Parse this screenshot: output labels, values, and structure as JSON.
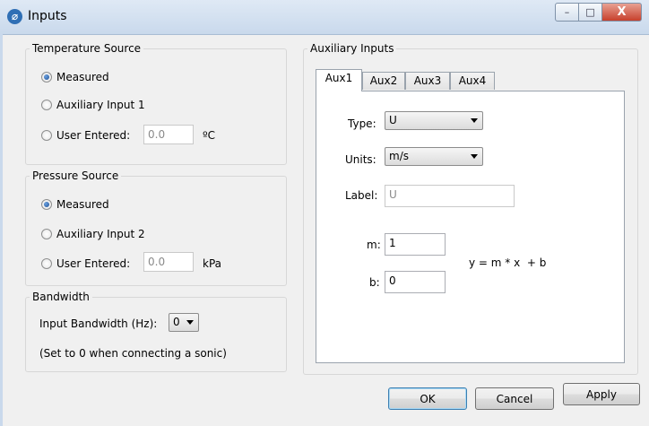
{
  "window": {
    "title": "Inputs",
    "app_icon": "app-logo-icon",
    "controls": {
      "minimize": "–",
      "maximize": "□",
      "close": "X"
    }
  },
  "temperature_source": {
    "legend": "Temperature Source",
    "options": [
      "Measured",
      "Auxiliary Input 1",
      "User Entered:"
    ],
    "selected": "Measured",
    "user_value": "0.0",
    "unit": "ºC"
  },
  "pressure_source": {
    "legend": "Pressure Source",
    "options": [
      "Measured",
      "Auxiliary Input 2",
      "User Entered:"
    ],
    "selected": "Measured",
    "user_value": "0.0",
    "unit": "kPa"
  },
  "bandwidth": {
    "legend": "Bandwidth",
    "label": "Input Bandwidth (Hz):",
    "value": "0",
    "note": "(Set to 0 when connecting a sonic)"
  },
  "auxiliary_inputs": {
    "legend": "Auxiliary Inputs",
    "tabs": [
      "Aux1",
      "Aux2",
      "Aux3",
      "Aux4"
    ],
    "active_tab": "Aux1",
    "type_label": "Type:",
    "type_value": "U",
    "units_label": "Units:",
    "units_value": "m/s",
    "label_label": "Label:",
    "label_placeholder": "U",
    "m_label": "m:",
    "m_value": "1",
    "b_label": "b:",
    "b_value": "0",
    "formula": "y = m * x  + b"
  },
  "buttons": {
    "ok": "OK",
    "cancel": "Cancel",
    "apply": "Apply"
  },
  "colors": {
    "titlebar": "#c9d9ec",
    "close_button": "#c7402c",
    "radio_checked": "#1f4f94"
  }
}
